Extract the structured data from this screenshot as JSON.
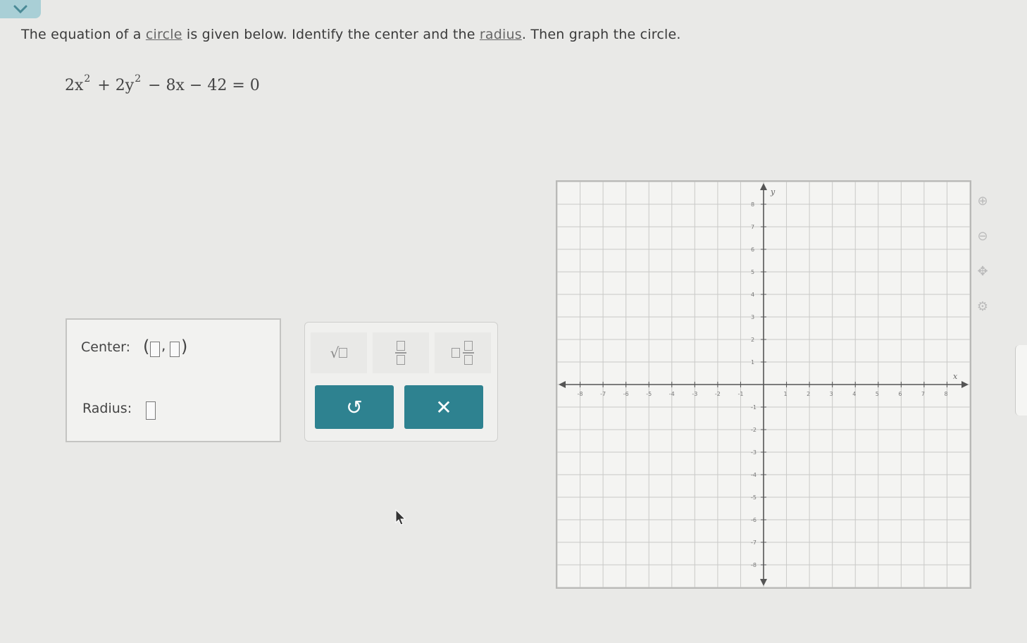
{
  "prompt": {
    "part1": "The equation of a ",
    "term1": "circle",
    "part2": " is given below. Identify the center and the ",
    "term2": "radius",
    "part3": ". Then graph the circle."
  },
  "equation": {
    "t1": "2x",
    "e1": "2",
    "t2": "+ 2y",
    "e2": "2",
    "t3": "− 8x − 42 = 0"
  },
  "answer": {
    "center_label": "Center:",
    "center_open": "(",
    "center_comma": ",",
    "center_close": ")",
    "radius_label": "Radius:"
  },
  "toolpad": {
    "sqrt_symbol": "√",
    "undo_symbol": "↺",
    "clear_symbol": "✕"
  },
  "graph": {
    "x_axis_label": "x",
    "y_axis_label": "y",
    "x_min": -9,
    "x_max": 9,
    "y_min": -9,
    "y_max": 9,
    "x_ticks": [
      "-8",
      "-7",
      "-6",
      "-5",
      "-4",
      "-3",
      "-2",
      "-1",
      "1",
      "2",
      "3",
      "4",
      "5",
      "6",
      "7",
      "8"
    ],
    "y_ticks": [
      "8",
      "7",
      "6",
      "5",
      "4",
      "3",
      "2",
      "1",
      "-1",
      "-2",
      "-3",
      "-4",
      "-5",
      "-6",
      "-7",
      "-8"
    ],
    "grid_color": "#c9c9c7",
    "axis_color": "#555555"
  },
  "colors": {
    "accent": "#2e8290",
    "tab": "#a9cfd6"
  }
}
